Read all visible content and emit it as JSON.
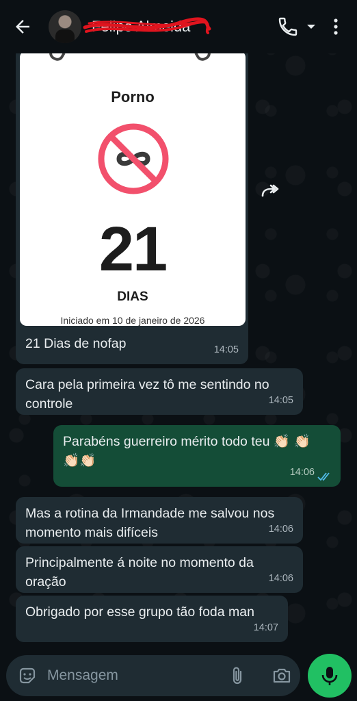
{
  "header": {
    "contact_name": "Felipe Almeida"
  },
  "icons": {
    "back": "arrow-left-icon",
    "call": "phone-icon",
    "dropdown": "chevron-down-icon",
    "menu": "more-vert-icon",
    "forward": "forward-icon",
    "emoji": "sticker-icon",
    "attach": "paperclip-icon",
    "camera": "camera-icon",
    "mic": "microphone-icon"
  },
  "colors": {
    "incoming_bubble": "#1f2c33",
    "outgoing_bubble": "#144d37",
    "accent_green": "#21c063",
    "read_ticks": "#53bdeb"
  },
  "image_message": {
    "card": {
      "title": "Porno",
      "days_number": "21",
      "days_label": "DIAS",
      "started": "Iniciado em 10 de janeiro de 2026"
    },
    "caption": "21 Dias de nofap",
    "time": "14:05"
  },
  "messages": [
    {
      "direction": "in",
      "text": "Cara pela primeira vez tô me sentindo no controle",
      "time": "14:05"
    },
    {
      "direction": "out",
      "text": "Parabéns guerreiro mérito todo teu 👏🏻 👏🏻👏🏻👏🏻",
      "time": "14:06"
    },
    {
      "direction": "in",
      "text": "Mas a rotina da Irmandade me salvou nos momento mais difíceis",
      "time": "14:06"
    },
    {
      "direction": "in",
      "text": "Principalmente á noite no momento da oração",
      "time": "14:06"
    },
    {
      "direction": "in",
      "text": "Obrigado por esse grupo tão foda man",
      "time": "14:07"
    }
  ],
  "composer": {
    "placeholder": "Mensagem"
  }
}
